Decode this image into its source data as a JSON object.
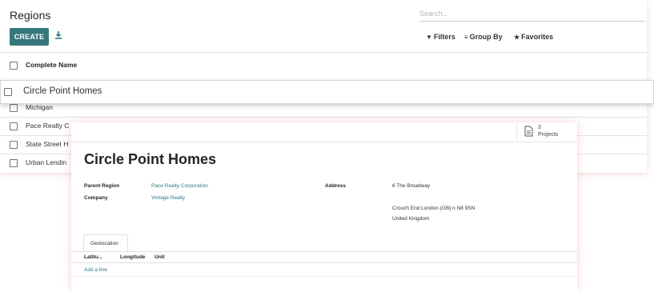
{
  "list": {
    "title": "Regions",
    "search_placeholder": "Search...",
    "create_label": "CREATE",
    "filters_label": "Filters",
    "group_by_label": "Group By",
    "favorites_label": "Favorites",
    "column_header": "Complete Name",
    "rows": [
      {
        "name": "Circle Point Homes"
      },
      {
        "name": "Michigan"
      },
      {
        "name": "Pace Realty C"
      },
      {
        "name": "State Street H"
      },
      {
        "name": "Urban Lendin"
      }
    ]
  },
  "form": {
    "record_name": "Circle Point Homes",
    "projects_count": "3",
    "projects_label": "Projects",
    "parent_region_label": "Parent Region",
    "parent_region_value": "Pace Realty Corporation",
    "company_label": "Company",
    "company_value": "Vintage Realty",
    "address_label": "Address",
    "address_line1": "6 The Broadway",
    "address_line2": "Crouch End  London (GB)  n N8 9SN",
    "address_line3": "United Kingdom",
    "tab_label": "Geolocation",
    "col_latitude": "Latitu...",
    "col_longitude": "Longitude",
    "col_unit": "Unit",
    "add_line_label": "Add a line"
  },
  "colors": {
    "primary": "#35777b",
    "link": "#2b7b84"
  }
}
